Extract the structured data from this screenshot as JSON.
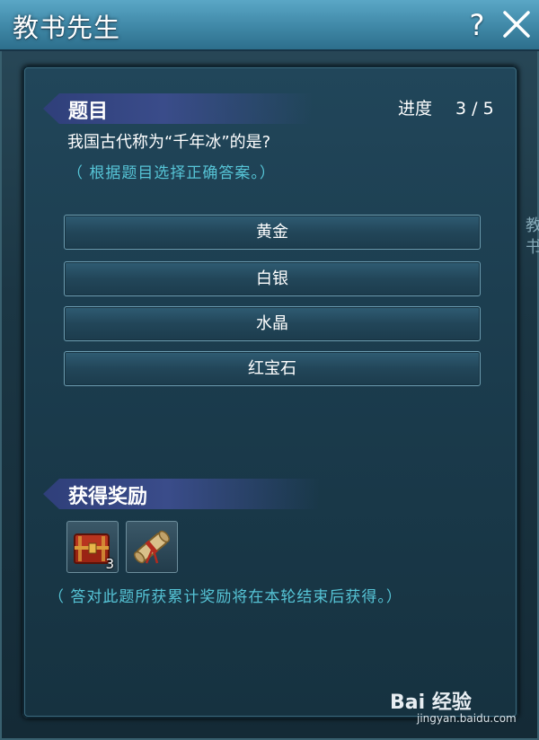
{
  "window": {
    "title": "教书先生"
  },
  "question_section": {
    "header": "题目"
  },
  "progress": {
    "label": "进度",
    "current": "3",
    "total": "5",
    "display": "3 / 5"
  },
  "question": {
    "text": "我国古代称为“千年冰”的是?",
    "hint": "（ 根据题目选择正确答案。）"
  },
  "answers": [
    {
      "label": "黄金"
    },
    {
      "label": "白银"
    },
    {
      "label": "水晶"
    },
    {
      "label": "红宝石"
    }
  ],
  "reward_section": {
    "header": "获得奖励"
  },
  "rewards": [
    {
      "icon": "treasure-chest-icon",
      "count": "3"
    },
    {
      "icon": "scroll-icon",
      "count": ""
    }
  ],
  "reward_note": "（ 答对此题所获累计奖励将在本轮结束后获得。）",
  "side_text": "教\n书",
  "watermark": {
    "brand": "Bai 经验",
    "url": "jingyan.baidu.com"
  }
}
